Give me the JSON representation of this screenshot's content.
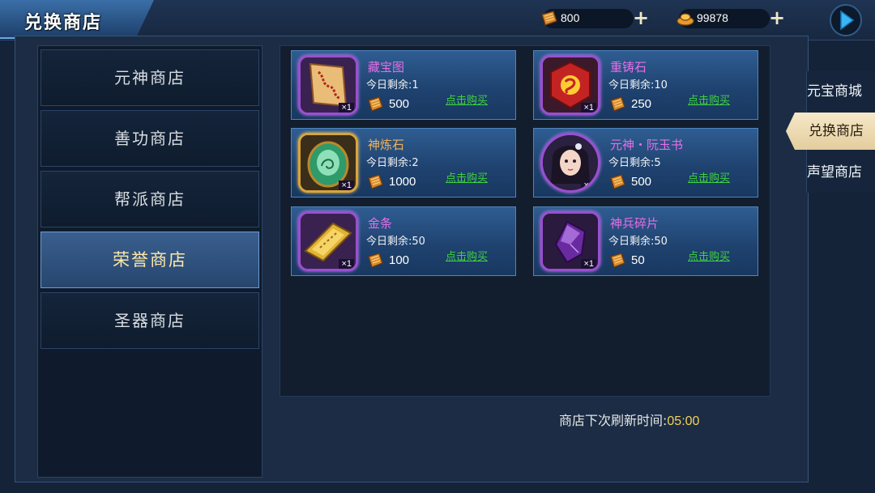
{
  "header": {
    "title": "兑换商店",
    "currency1": {
      "icon": "coin-bundle-icon",
      "value": "800"
    },
    "currency2": {
      "icon": "gold-ingot-icon",
      "value": "99878"
    },
    "plus_label": "+"
  },
  "categories": [
    {
      "label": "元神商店",
      "active": false
    },
    {
      "label": "善功商店",
      "active": false
    },
    {
      "label": "帮派商店",
      "active": false
    },
    {
      "label": "荣誉商店",
      "active": true
    },
    {
      "label": "圣器商店",
      "active": false
    }
  ],
  "items": [
    {
      "name": "藏宝图",
      "remain": "今日剩余:1",
      "price": "500",
      "qty": "×1",
      "buy": "点击购买",
      "icon": "treasure-map-icon"
    },
    {
      "name": "重铸石",
      "remain": "今日剩余:10",
      "price": "250",
      "qty": "×1",
      "buy": "点击购买",
      "icon": "recast-stone-icon"
    },
    {
      "name": "神炼石",
      "remain": "今日剩余:2",
      "price": "1000",
      "qty": "×1",
      "buy": "点击购买",
      "icon": "refine-stone-icon"
    },
    {
      "name": "元神・阮玉书",
      "remain": "今日剩余:5",
      "price": "500",
      "qty": "×1",
      "buy": "点击购买",
      "icon": "character-portrait-icon"
    },
    {
      "name": "金条",
      "remain": "今日剩余:50",
      "price": "100",
      "qty": "×1",
      "buy": "点击购买",
      "icon": "gold-bar-icon"
    },
    {
      "name": "神兵碎片",
      "remain": "今日剩余:50",
      "price": "50",
      "qty": "×1",
      "buy": "点击购买",
      "icon": "weapon-shard-icon"
    }
  ],
  "refresh": {
    "label": "商店下次刷新时间:",
    "time": "05:00"
  },
  "right_tabs": [
    {
      "label": "元宝商城",
      "active": false
    },
    {
      "label": "兑换商店",
      "active": true
    },
    {
      "label": "声望商店",
      "active": false
    }
  ],
  "colors": {
    "accent": "#ffe9a8",
    "buy": "#3ed33e",
    "item_name": "#e66ee6",
    "timer": "#f2d35a"
  }
}
